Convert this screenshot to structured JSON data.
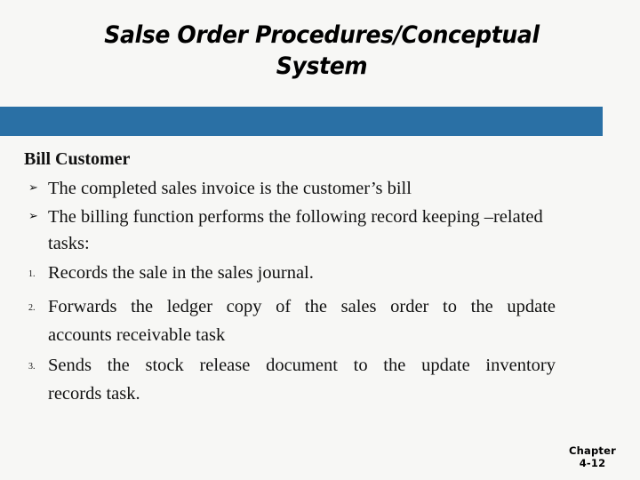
{
  "slide": {
    "background_color": "#f7f7f5",
    "accent_color": "#2a70a5",
    "text_color": "#111111"
  },
  "title": {
    "line1": "Salse Order Procedures/Conceptual",
    "line2": "System"
  },
  "body": {
    "heading": "Bill Customer",
    "bullets": [
      {
        "marker": "➢",
        "marker_name": "chevron-bullet",
        "text": "The completed sales invoice is the customer’s bill"
      },
      {
        "marker": "➢",
        "marker_name": "chevron-bullet",
        "line1": "The billing function performs the following record keeping",
        "line2": "–related tasks:"
      }
    ],
    "numbered": [
      {
        "marker": "1.",
        "text": "Records the sale in the sales journal."
      },
      {
        "marker": "2.",
        "line1": "Forwards the ledger copy of the sales order to the update",
        "line2": "accounts receivable task"
      },
      {
        "marker": "3.",
        "line1": "Sends the stock release document to the update inventory",
        "line2": "records task."
      }
    ]
  },
  "footer": {
    "label": "Chapter",
    "number": "4-12"
  }
}
